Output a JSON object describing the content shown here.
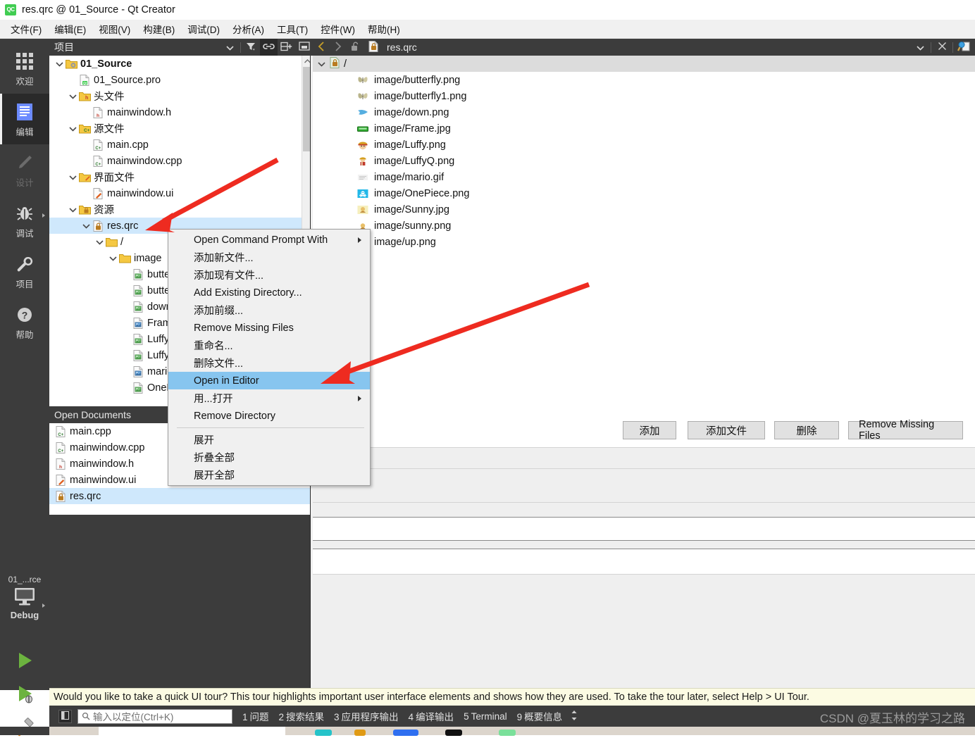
{
  "window": {
    "title": "res.qrc @ 01_Source - Qt Creator",
    "app_icon": "qt-creator-icon",
    "icon_text": "QC"
  },
  "menubar": [
    {
      "label": "文件(F)",
      "accel": "F"
    },
    {
      "label": "编辑(E)",
      "accel": "E"
    },
    {
      "label": "视图(V)",
      "accel": "V"
    },
    {
      "label": "构建(B)",
      "accel": "B"
    },
    {
      "label": "调试(D)",
      "accel": "D"
    },
    {
      "label": "分析(A)",
      "accel": "A"
    },
    {
      "label": "工具(T)",
      "accel": "T"
    },
    {
      "label": "控件(W)",
      "accel": "W"
    },
    {
      "label": "帮助(H)",
      "accel": "H"
    }
  ],
  "modebar": {
    "modes": [
      {
        "label": "欢迎",
        "icon": "grid-icon",
        "selected": false,
        "disabled": false
      },
      {
        "label": "编辑",
        "icon": "edit-document-icon",
        "selected": true,
        "disabled": false
      },
      {
        "label": "设计",
        "icon": "pencil-icon",
        "selected": false,
        "disabled": true
      },
      {
        "label": "调试",
        "icon": "bug-icon",
        "selected": false,
        "disabled": false
      },
      {
        "label": "项目",
        "icon": "wrench-icon",
        "selected": false,
        "disabled": false
      },
      {
        "label": "帮助",
        "icon": "question-circle-icon",
        "selected": false,
        "disabled": false
      }
    ],
    "kit": {
      "project": "01_...rce",
      "config": "Debug",
      "icon": "monitor-icon"
    },
    "actions": [
      {
        "name": "run-button",
        "icon": "green-play-icon"
      },
      {
        "name": "debug-button",
        "icon": "green-play-bug-icon"
      },
      {
        "name": "build-button",
        "icon": "hammer-icon"
      }
    ]
  },
  "sidepanel": {
    "title": "项目",
    "toolbar": [
      {
        "name": "view-selector-dropdown",
        "icon": "chevron-down-icon",
        "active": false
      },
      {
        "name": "filter-button",
        "icon": "filter-icon",
        "active": false
      },
      {
        "name": "sync-with-editor-button",
        "icon": "link-icon",
        "active": true
      },
      {
        "name": "split-button",
        "icon": "split-add-icon",
        "active": false
      },
      {
        "name": "close-sidebar-button",
        "icon": "close-panel-icon",
        "active": false
      }
    ],
    "tree": [
      {
        "label": "01_Source",
        "indent": 0,
        "chevron": "down",
        "icon": "project-folder-icon",
        "bold": true,
        "selected": false
      },
      {
        "label": "01_Source.pro",
        "indent": 1,
        "chevron": "none",
        "icon": "qt-pro-file-icon",
        "bold": false,
        "selected": false
      },
      {
        "label": "头文件",
        "indent": 1,
        "chevron": "down",
        "icon": "header-folder-icon",
        "bold": false,
        "selected": false
      },
      {
        "label": "mainwindow.h",
        "indent": 2,
        "chevron": "none",
        "icon": "h-file-icon",
        "bold": false,
        "selected": false
      },
      {
        "label": "源文件",
        "indent": 1,
        "chevron": "down",
        "icon": "cpp-folder-icon",
        "bold": false,
        "selected": false
      },
      {
        "label": "main.cpp",
        "indent": 2,
        "chevron": "none",
        "icon": "cpp-file-icon",
        "bold": false,
        "selected": false
      },
      {
        "label": "mainwindow.cpp",
        "indent": 2,
        "chevron": "none",
        "icon": "cpp-file-icon",
        "bold": false,
        "selected": false
      },
      {
        "label": "界面文件",
        "indent": 1,
        "chevron": "down",
        "icon": "ui-folder-icon",
        "bold": false,
        "selected": false
      },
      {
        "label": "mainwindow.ui",
        "indent": 2,
        "chevron": "none",
        "icon": "ui-file-icon",
        "bold": false,
        "selected": false
      },
      {
        "label": "资源",
        "indent": 1,
        "chevron": "down",
        "icon": "qrc-folder-icon",
        "bold": false,
        "selected": false
      },
      {
        "label": "res.qrc",
        "indent": 2,
        "chevron": "down",
        "icon": "qrc-file-icon",
        "bold": false,
        "selected": true
      },
      {
        "label": "/",
        "indent": 3,
        "chevron": "down",
        "icon": "folder-icon",
        "bold": false,
        "selected": false
      },
      {
        "label": "image",
        "indent": 4,
        "chevron": "down",
        "icon": "folder-icon",
        "bold": false,
        "selected": false
      },
      {
        "label": "butte",
        "indent": 5,
        "chevron": "none",
        "icon": "image-green-icon",
        "bold": false,
        "selected": false
      },
      {
        "label": "butte",
        "indent": 5,
        "chevron": "none",
        "icon": "image-green-icon",
        "bold": false,
        "selected": false
      },
      {
        "label": "down",
        "indent": 5,
        "chevron": "none",
        "icon": "image-green-icon",
        "bold": false,
        "selected": false
      },
      {
        "label": "Frame",
        "indent": 5,
        "chevron": "none",
        "icon": "image-blue-icon",
        "bold": false,
        "selected": false
      },
      {
        "label": "Luffy.",
        "indent": 5,
        "chevron": "none",
        "icon": "image-green-icon",
        "bold": false,
        "selected": false
      },
      {
        "label": "LuffyQ",
        "indent": 5,
        "chevron": "none",
        "icon": "image-green-icon",
        "bold": false,
        "selected": false
      },
      {
        "label": "mario",
        "indent": 5,
        "chevron": "none",
        "icon": "image-blue-icon",
        "bold": false,
        "selected": false
      },
      {
        "label": "OnePi",
        "indent": 5,
        "chevron": "none",
        "icon": "image-green-icon",
        "bold": false,
        "selected": false
      }
    ],
    "open_documents": {
      "title": "Open Documents",
      "items": [
        {
          "label": "main.cpp",
          "icon": "cpp-file-icon",
          "selected": false
        },
        {
          "label": "mainwindow.cpp",
          "icon": "cpp-file-icon",
          "selected": false
        },
        {
          "label": "mainwindow.h",
          "icon": "h-file-icon",
          "selected": false
        },
        {
          "label": "mainwindow.ui",
          "icon": "ui-file-icon",
          "selected": false
        },
        {
          "label": "res.qrc",
          "icon": "qrc-file-icon",
          "selected": true
        }
      ]
    }
  },
  "editor": {
    "toolbar": {
      "back": "back-arrow-icon",
      "forward": "forward-arrow-icon",
      "lock": "unlocked-padlock-icon",
      "file_icon": "qrc-file-icon",
      "filename": "res.qrc",
      "dropdown": "chevron-down-icon",
      "close": "close-icon",
      "split": "split-editor-icon"
    },
    "root_node": {
      "label": "/",
      "icon": "qrc-prefix-icon",
      "chevron": "down"
    },
    "resources": [
      {
        "label": "image/butterfly.png",
        "icon": "butterfly-thumb"
      },
      {
        "label": "image/butterfly1.png",
        "icon": "butterfly-thumb"
      },
      {
        "label": "image/down.png",
        "icon": "bird-down-thumb"
      },
      {
        "label": "image/Frame.jpg",
        "icon": "green-frame-thumb"
      },
      {
        "label": "image/Luffy.png",
        "icon": "luffy-thumb"
      },
      {
        "label": "image/LuffyQ.png",
        "icon": "luffyq-thumb"
      },
      {
        "label": "image/mario.gif",
        "icon": "mario-thumb"
      },
      {
        "label": "image/OnePiece.png",
        "icon": "onepiece-thumb"
      },
      {
        "label": "image/Sunny.jpg",
        "icon": "sunny-jpg-thumb"
      },
      {
        "label": "image/sunny.png",
        "icon": "sunny-png-thumb"
      },
      {
        "label": "image/up.png",
        "icon": "bird-up-thumb"
      }
    ],
    "buttons": [
      {
        "label": "添加",
        "name": "add-button",
        "occluded": true
      },
      {
        "label": "添加文件",
        "name": "add-files-button",
        "occluded": false
      },
      {
        "label": "删除",
        "name": "remove-button",
        "occluded": false
      },
      {
        "label": "Remove Missing Files",
        "name": "remove-missing-files-button",
        "occluded": false
      }
    ]
  },
  "context_menu": {
    "items": [
      {
        "label": "Open Command Prompt With",
        "submenu": true,
        "highlighted": false,
        "separator_after": false
      },
      {
        "label": "添加新文件...",
        "submenu": false,
        "highlighted": false,
        "separator_after": false
      },
      {
        "label": "添加现有文件...",
        "submenu": false,
        "highlighted": false,
        "separator_after": false
      },
      {
        "label": "Add Existing Directory...",
        "submenu": false,
        "highlighted": false,
        "separator_after": false
      },
      {
        "label": "添加前缀...",
        "submenu": false,
        "highlighted": false,
        "separator_after": false
      },
      {
        "label": "Remove Missing Files",
        "submenu": false,
        "highlighted": false,
        "separator_after": false
      },
      {
        "label": "重命名...",
        "submenu": false,
        "highlighted": false,
        "separator_after": false
      },
      {
        "label": "删除文件...",
        "submenu": false,
        "highlighted": false,
        "separator_after": false
      },
      {
        "label": "Open in Editor",
        "submenu": false,
        "highlighted": true,
        "separator_after": false
      },
      {
        "label": "用...打开",
        "submenu": true,
        "highlighted": false,
        "separator_after": false
      },
      {
        "label": "Remove Directory",
        "submenu": false,
        "highlighted": false,
        "separator_after": true
      },
      {
        "label": "展开",
        "submenu": false,
        "highlighted": false,
        "separator_after": false
      },
      {
        "label": "折叠全部",
        "submenu": false,
        "highlighted": false,
        "separator_after": false
      },
      {
        "label": "展开全部",
        "submenu": false,
        "highlighted": false,
        "separator_after": false
      }
    ]
  },
  "tour_banner": {
    "text": "Would you like to take a quick UI tour? This tour highlights important user interface elements and shows how they are used. To take the tour later, select Help > UI Tour."
  },
  "statusbar": {
    "toggle_icon": "sidebar-toggle-icon",
    "locator_placeholder": "输入以定位(Ctrl+K)",
    "search_icon": "search-icon",
    "outputs": [
      {
        "num": "1",
        "label": "问题"
      },
      {
        "num": "2",
        "label": "搜索结果"
      },
      {
        "num": "3",
        "label": "应用程序输出"
      },
      {
        "num": "4",
        "label": "编译输出"
      },
      {
        "num": "5",
        "label": "Terminal"
      },
      {
        "num": "9",
        "label": "概要信息"
      }
    ],
    "updown_icon": "up-down-arrows-icon"
  },
  "watermark": {
    "text": "CSDN @夏玉林的学习之路"
  },
  "annotations": {
    "arrows": [
      {
        "name": "arrow-to-res-qrc",
        "color": "#ee2b20"
      },
      {
        "name": "arrow-to-open-in-editor",
        "color": "#ee2b20"
      }
    ],
    "color": "#ee2b20"
  },
  "colors": {
    "dark_chrome": "#3c3c3c",
    "mode_selected": "#2a2a2a",
    "tree_selection": "#cfe8fc",
    "menu_highlight": "#87c5ef",
    "tour_banner": "#fcfbe3",
    "annotation_red": "#ee2b20",
    "qt_green": "#41cd52"
  }
}
